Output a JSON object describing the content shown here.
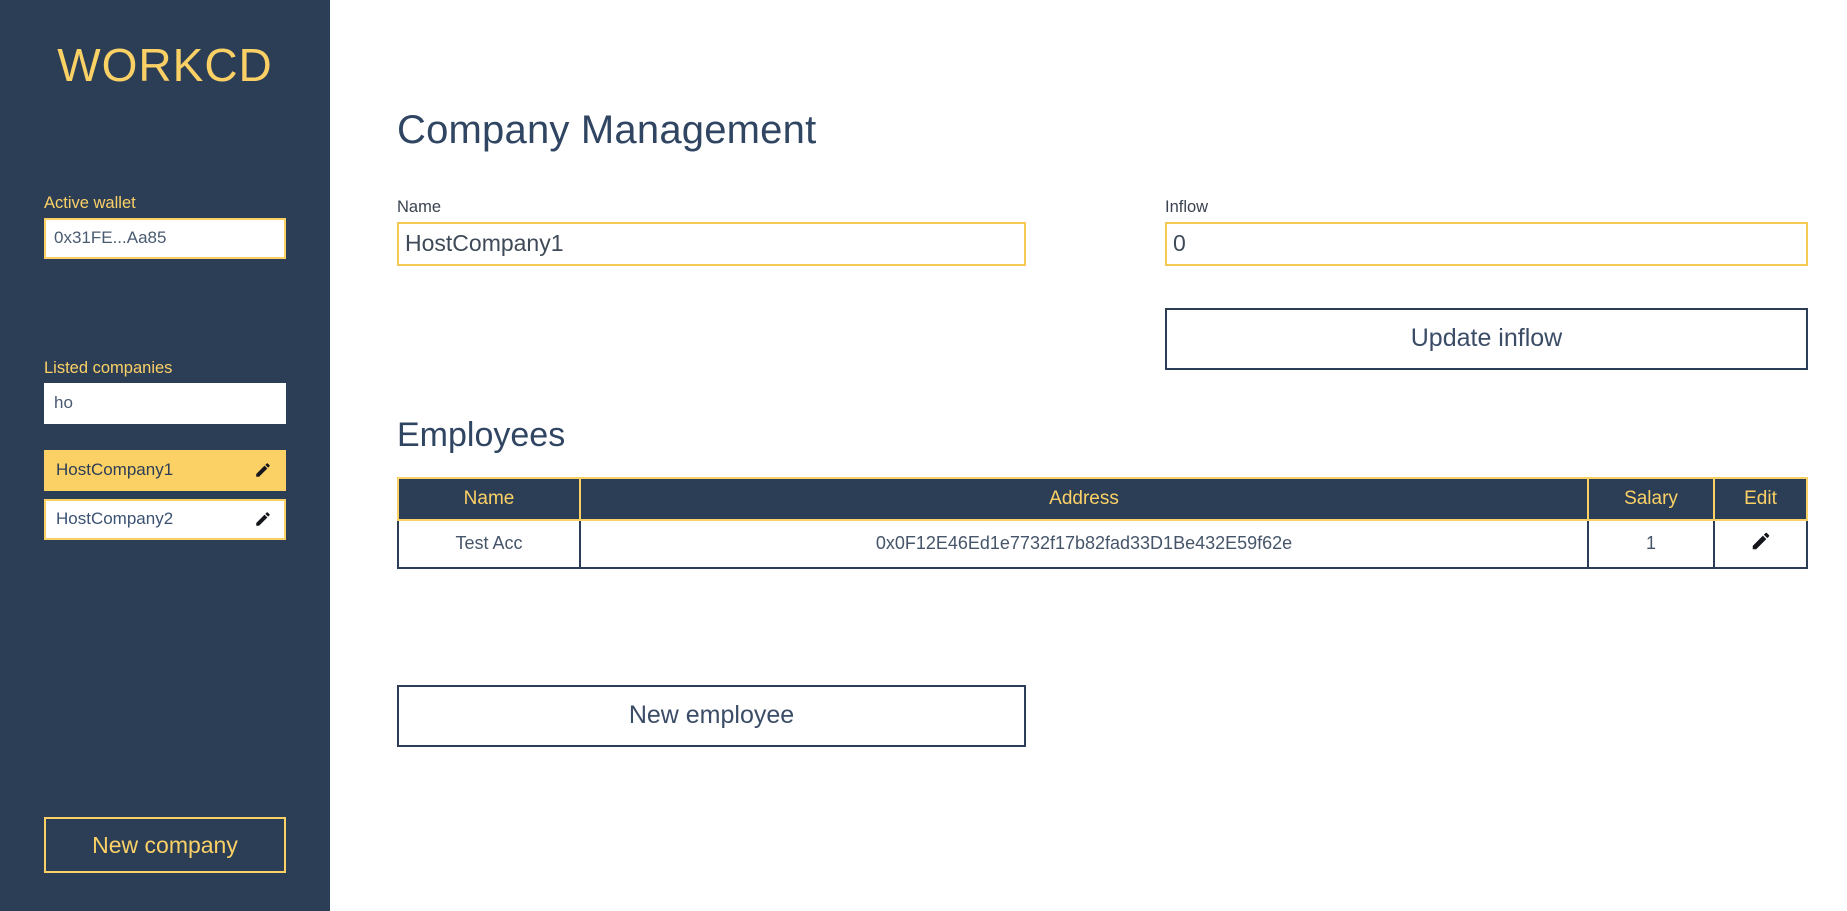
{
  "sidebar": {
    "logo": "WORKCD",
    "wallet": {
      "label": "Active wallet",
      "value": "0x31FE...Aa85",
      "placeholder": ""
    },
    "companies": {
      "label": "Listed companies",
      "filter_value": "ho",
      "filter_placeholder": "",
      "items": [
        {
          "name": "HostCompany1",
          "selected": true,
          "edit_icon": "pencil-icon"
        },
        {
          "name": "HostCompany2",
          "selected": false,
          "edit_icon": "pencil-icon"
        }
      ]
    },
    "new_company_label": "New company"
  },
  "main": {
    "page_title": "Company Management",
    "name_field": {
      "label": "Name",
      "value": "HostCompany1",
      "placeholder": ""
    },
    "inflow_field": {
      "label": "Inflow",
      "value": "0",
      "placeholder": ""
    },
    "update_inflow_label": "Update inflow",
    "employees_title": "Employees",
    "employees_table": {
      "columns": [
        "Name",
        "Address",
        "Salary",
        "Edit"
      ],
      "rows": [
        {
          "name": "Test Acc",
          "address": "0x0F12E46Ed1e7732f17b82fad33D1Be432E59f62e",
          "salary": "1",
          "edit_icon": "pencil-icon"
        }
      ]
    },
    "new_employee_label": "New employee"
  },
  "colors": {
    "sidebar_bg": "#2c3e56",
    "accent_yellow": "#fbd166",
    "text_navy": "#2f4562",
    "page_bg": "#ffffff"
  }
}
